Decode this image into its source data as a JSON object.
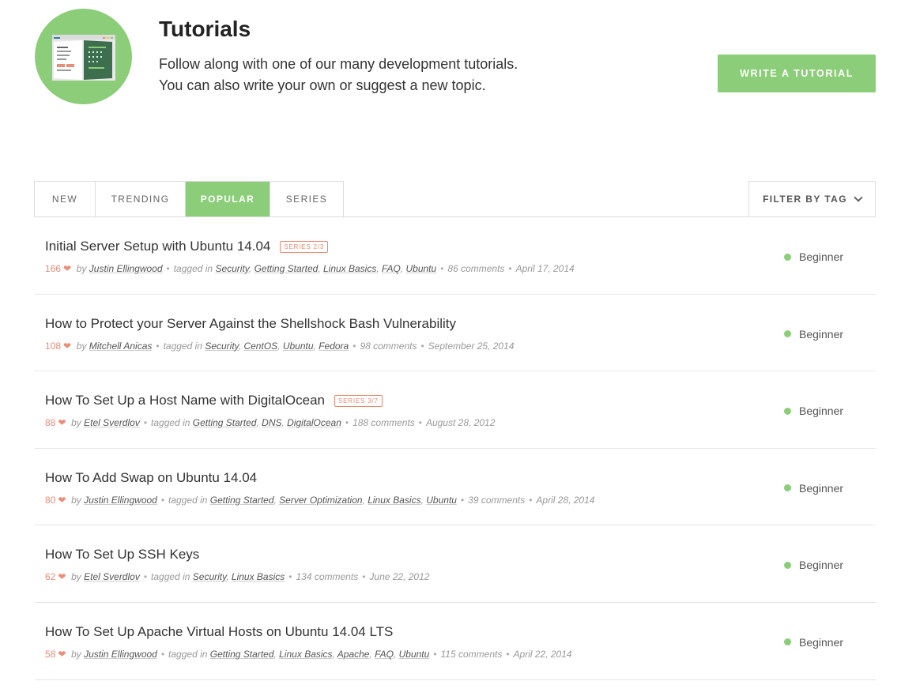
{
  "header": {
    "title": "Tutorials",
    "desc_line1": "Follow along with one of our many development tutorials.",
    "desc_line2": "You can also write your own or suggest a new topic.",
    "write_button": "WRITE A TUTORIAL",
    "icon": "book-icon"
  },
  "tabs": [
    {
      "label": "NEW",
      "active": false
    },
    {
      "label": "TRENDING",
      "active": false
    },
    {
      "label": "POPULAR",
      "active": true
    },
    {
      "label": "SERIES",
      "active": false
    }
  ],
  "filter_label": "FILTER BY TAG",
  "colors": {
    "accent": "#8ccd79",
    "heart": "#e88d78",
    "badge": "#e38a72"
  },
  "tutorials": [
    {
      "title": "Initial Server Setup with Ubuntu 14.04",
      "series": "SERIES 2/3",
      "likes": "166",
      "by": "by",
      "author": "Justin Ellingwood",
      "tagged_in": "tagged in",
      "tags": [
        "Security",
        "Getting Started",
        "Linux Basics",
        "FAQ",
        "Ubuntu"
      ],
      "comments": "86 comments",
      "date": "April 17, 2014",
      "level": "Beginner"
    },
    {
      "title": "How to Protect your Server Against the Shellshock Bash Vulnerability",
      "series": "",
      "likes": "108",
      "by": "by",
      "author": "Mitchell Anicas",
      "tagged_in": "tagged in",
      "tags": [
        "Security",
        "CentOS",
        "Ubuntu",
        "Fedora"
      ],
      "comments": "98 comments",
      "date": "September 25, 2014",
      "level": "Beginner"
    },
    {
      "title": "How To Set Up a Host Name with DigitalOcean",
      "series": "SERIES 3/7",
      "likes": "88",
      "by": "by",
      "author": "Etel Sverdlov",
      "tagged_in": "tagged in",
      "tags": [
        "Getting Started",
        "DNS",
        "DigitalOcean"
      ],
      "comments": "188 comments",
      "date": "August 28, 2012",
      "level": "Beginner"
    },
    {
      "title": "How To Add Swap on Ubuntu 14.04",
      "series": "",
      "likes": "80",
      "by": "by",
      "author": "Justin Ellingwood",
      "tagged_in": "tagged in",
      "tags": [
        "Getting Started",
        "Server Optimization",
        "Linux Basics",
        "Ubuntu"
      ],
      "comments": "39 comments",
      "date": "April 28, 2014",
      "level": "Beginner"
    },
    {
      "title": "How To Set Up SSH Keys",
      "series": "",
      "likes": "62",
      "by": "by",
      "author": "Etel Sverdlov",
      "tagged_in": "tagged in",
      "tags": [
        "Security",
        "Linux Basics"
      ],
      "comments": "134 comments",
      "date": "June 22, 2012",
      "level": "Beginner"
    },
    {
      "title": "How To Set Up Apache Virtual Hosts on Ubuntu 14.04 LTS",
      "series": "",
      "likes": "58",
      "by": "by",
      "author": "Justin Ellingwood",
      "tagged_in": "tagged in",
      "tags": [
        "Getting Started",
        "Linux Basics",
        "Apache",
        "FAQ",
        "Ubuntu"
      ],
      "comments": "115 comments",
      "date": "April 22, 2014",
      "level": "Beginner"
    }
  ]
}
